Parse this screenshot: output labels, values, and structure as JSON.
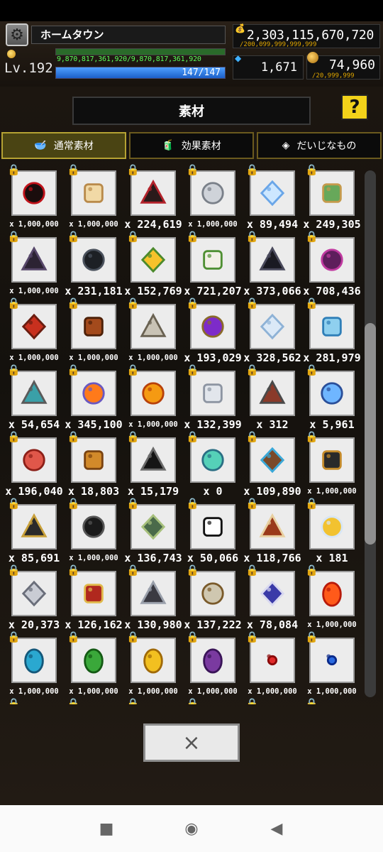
{
  "header": {
    "town_name": "ホームタウン",
    "level_label": "Lv.192",
    "exp_text": "9,870,817,361,920/9,870,817,361,920",
    "exp_fraction": 1.0,
    "hp_text": "147/147",
    "hp_fraction": 1.0,
    "gold_value": "2,303,115,670,720",
    "gold_cap": "/200,099,999,999,999",
    "gem_value": "1,671",
    "medal_value": "74,960",
    "medal_cap": "/20,999,999"
  },
  "panel": {
    "title": "素材",
    "help_label": "?",
    "tabs": [
      {
        "label": "通常素材",
        "icon": "bowl-icon",
        "active": true
      },
      {
        "label": "効果素材",
        "icon": "carton-icon",
        "active": false
      },
      {
        "label": "だいじなもの",
        "icon": "cube-icon",
        "active": false
      }
    ],
    "close_label": "×",
    "scroll_fraction": 0.4
  },
  "items": [
    {
      "name": "red-eye-orb",
      "count": "x 1,000,000",
      "colors": [
        "#1a0d0d",
        "#c0121a"
      ]
    },
    {
      "name": "fish-bone",
      "count": "x 1,000,000",
      "colors": [
        "#f1d9a6",
        "#b98a4a"
      ]
    },
    {
      "name": "black-spider",
      "count": "x 224,619",
      "colors": [
        "#2a1a1a",
        "#b3222b"
      ]
    },
    {
      "name": "grey-fur",
      "count": "x 1,000,000",
      "colors": [
        "#cfd3d9",
        "#7a8089"
      ]
    },
    {
      "name": "ice-crystal",
      "count": "x 89,494",
      "colors": [
        "#cde7ff",
        "#6aa6e8"
      ]
    },
    {
      "name": "green-potion",
      "count": "x 249,305",
      "colors": [
        "#67a85a",
        "#c49a4b"
      ]
    },
    {
      "name": "bat-wing",
      "count": "x 1,000,000",
      "colors": [
        "#2c2333",
        "#57476a"
      ]
    },
    {
      "name": "dark-cross",
      "count": "x 231,181",
      "colors": [
        "#1d2025",
        "#4a515c"
      ]
    },
    {
      "name": "sunflower",
      "count": "x 152,769",
      "colors": [
        "#f6c22b",
        "#4c8a2c"
      ]
    },
    {
      "name": "cotton-plant",
      "count": "x 721,207",
      "colors": [
        "#f3f0e6",
        "#4e8f32"
      ]
    },
    {
      "name": "black-cat",
      "count": "x 373,066",
      "colors": [
        "#1a1a22",
        "#4a4a5c"
      ]
    },
    {
      "name": "purple-pod",
      "count": "x 708,436",
      "colors": [
        "#5e1e5c",
        "#c03aa0"
      ]
    },
    {
      "name": "red-banner",
      "count": "x 1,000,000",
      "colors": [
        "#c8301e",
        "#6b1d10"
      ]
    },
    {
      "name": "bronze-cup",
      "count": "x 1,000,000",
      "colors": [
        "#a34a1c",
        "#4d2008"
      ]
    },
    {
      "name": "bone-flower",
      "count": "x 1,000,000",
      "colors": [
        "#c9c3b5",
        "#6a6252"
      ]
    },
    {
      "name": "purple-orb-altar",
      "count": "x 193,029",
      "colors": [
        "#7d2bc9",
        "#8a6a2a"
      ]
    },
    {
      "name": "cloud-puff",
      "count": "x 328,562",
      "colors": [
        "#dbe9f7",
        "#8eb2d6"
      ]
    },
    {
      "name": "water-cube",
      "count": "x 281,979",
      "colors": [
        "#8fd0ef",
        "#2f7fb8"
      ]
    },
    {
      "name": "globe-stand",
      "count": "x 54,654",
      "colors": [
        "#3aa0a8",
        "#5a5a5a"
      ]
    },
    {
      "name": "phoenix-flame",
      "count": "x 345,100",
      "colors": [
        "#ff7a1a",
        "#6a58c0"
      ]
    },
    {
      "name": "fire-orb",
      "count": "x 1,000,000",
      "colors": [
        "#f59a12",
        "#b8410a"
      ]
    },
    {
      "name": "silver-ore",
      "count": "x 132,399",
      "colors": [
        "#e2e6ec",
        "#8d95a2"
      ]
    },
    {
      "name": "wood-totem",
      "count": "x 312",
      "colors": [
        "#8a3a2a",
        "#4a4a4a"
      ]
    },
    {
      "name": "ice-shard",
      "count": "x 5,961",
      "colors": [
        "#6fb6ff",
        "#2a4f9a"
      ]
    },
    {
      "name": "red-pearl",
      "count": "x 196,040",
      "colors": [
        "#e0574a",
        "#8c1f18"
      ]
    },
    {
      "name": "golden-horn",
      "count": "x 18,803",
      "colors": [
        "#d28a2a",
        "#7a4310"
      ]
    },
    {
      "name": "black-claw",
      "count": "x 15,179",
      "colors": [
        "#151515",
        "#6a6a6a"
      ]
    },
    {
      "name": "teal-crystal",
      "count": "x 0",
      "colors": [
        "#55d1b8",
        "#2a6f84"
      ]
    },
    {
      "name": "gear-gem",
      "count": "x 109,890",
      "colors": [
        "#7a4a2a",
        "#3aa8d8"
      ]
    },
    {
      "name": "hook-key",
      "count": "x 1,000,000",
      "colors": [
        "#2a2a2a",
        "#c48a2a"
      ]
    },
    {
      "name": "dark-golem",
      "count": "x 85,691",
      "colors": [
        "#2a2a2a",
        "#c8a03a"
      ]
    },
    {
      "name": "black-lizard",
      "count": "x 1,000,000",
      "colors": [
        "#1a1a1a",
        "#555"
      ]
    },
    {
      "name": "moon-tile",
      "count": "x 136,743",
      "colors": [
        "#4a6a4a",
        "#a7c07c"
      ]
    },
    {
      "name": "sketch-bot",
      "count": "x 50,066",
      "colors": [
        "#ffffff",
        "#111111"
      ]
    },
    {
      "name": "war-drum",
      "count": "x 118,766",
      "colors": [
        "#9a3a1a",
        "#e8d0a0"
      ]
    },
    {
      "name": "angel-bell",
      "count": "x 181",
      "colors": [
        "#f2c230",
        "#d7e6f5"
      ]
    },
    {
      "name": "silver-feather",
      "count": "x 20,373",
      "colors": [
        "#c9ccd4",
        "#6a6e7a"
      ]
    },
    {
      "name": "red-harp",
      "count": "x 126,162",
      "colors": [
        "#b0281e",
        "#e0b94a"
      ]
    },
    {
      "name": "iron-chain",
      "count": "x 130,980",
      "colors": [
        "#3a3a42",
        "#9aa0ab"
      ]
    },
    {
      "name": "skull-lantern",
      "count": "x 137,222",
      "colors": [
        "#cfc7b0",
        "#7a5a2a"
      ]
    },
    {
      "name": "void-portal",
      "count": "x 78,084",
      "colors": [
        "#3a3aa8",
        "#d8d8f0"
      ]
    },
    {
      "name": "fire-egg",
      "count": "x 1,000,000",
      "colors": [
        "#ff5a1a",
        "#b81a0a"
      ]
    },
    {
      "name": "blue-egg",
      "count": "x 1,000,000",
      "colors": [
        "#2aa8d0",
        "#14587a"
      ]
    },
    {
      "name": "green-egg",
      "count": "x 1,000,000",
      "colors": [
        "#3aa83a",
        "#145a14"
      ]
    },
    {
      "name": "gold-egg",
      "count": "x 1,000,000",
      "colors": [
        "#f2c020",
        "#a06a08"
      ]
    },
    {
      "name": "purple-egg",
      "count": "x 1,000,000",
      "colors": [
        "#7a3aa0",
        "#3a1458"
      ]
    },
    {
      "name": "red-bead",
      "count": "x 1,000,000",
      "colors": [
        "#e02a2a",
        "#8a0a0a"
      ]
    },
    {
      "name": "blue-bead",
      "count": "x 1,000,000",
      "colors": [
        "#2a6ae0",
        "#0a2a8a"
      ]
    },
    {
      "name": "next-row-1",
      "count": "",
      "colors": [
        "#bbbbbb",
        "#888888"
      ]
    },
    {
      "name": "next-row-2",
      "count": "",
      "colors": [
        "#bbbbbb",
        "#888888"
      ]
    },
    {
      "name": "next-row-3",
      "count": "",
      "colors": [
        "#bbbbbb",
        "#888888"
      ]
    },
    {
      "name": "next-row-4",
      "count": "",
      "colors": [
        "#bbbbbb",
        "#888888"
      ]
    },
    {
      "name": "next-row-5",
      "count": "",
      "colors": [
        "#bbbbbb",
        "#888888"
      ]
    },
    {
      "name": "next-row-6",
      "count": "",
      "colors": [
        "#bbbbbb",
        "#888888"
      ]
    }
  ],
  "nav": [
    {
      "icon": "recents-square-icon",
      "glyph": "■"
    },
    {
      "icon": "home-circle-icon",
      "glyph": "◉"
    },
    {
      "icon": "back-triangle-icon",
      "glyph": "◀"
    }
  ]
}
